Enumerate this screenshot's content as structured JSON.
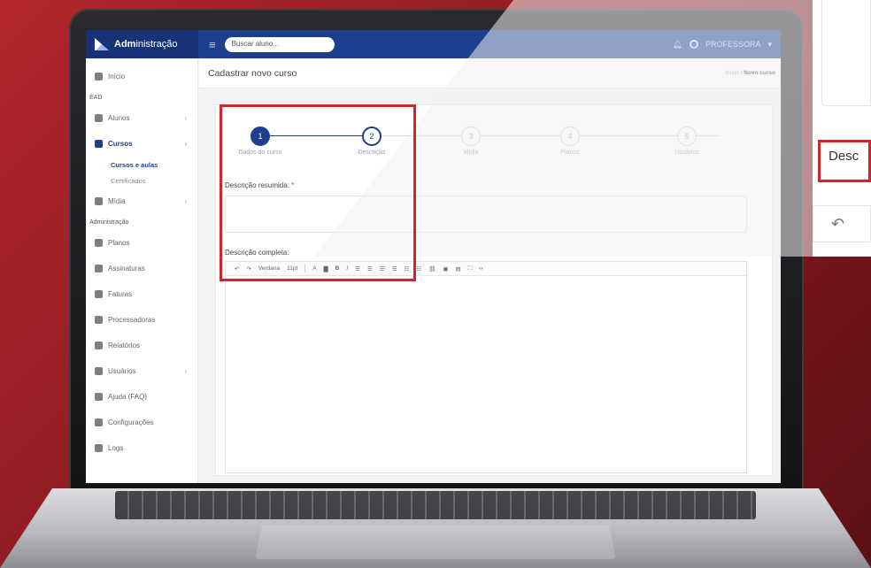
{
  "app": {
    "brand_bold": "Adm",
    "brand_rest": "inistração"
  },
  "topbar": {
    "search_placeholder": "Buscar aluno...",
    "user": "PROFESSORA"
  },
  "sidebar": {
    "items": [
      {
        "label": "Início",
        "icon": "home-icon"
      },
      {
        "section": "EAD"
      },
      {
        "label": "Alunos",
        "icon": "graduation-cap-icon",
        "chevron": true
      },
      {
        "label": "Cursos",
        "icon": "book-icon",
        "chevron": true,
        "active": true
      },
      {
        "sub": "Cursos e aulas",
        "active": true
      },
      {
        "sub": "Certificados"
      },
      {
        "label": "Mídia",
        "icon": "media-icon",
        "chevron": true
      },
      {
        "section": "Administração"
      },
      {
        "label": "Planos",
        "icon": "plane-icon"
      },
      {
        "label": "Assinaturas",
        "icon": "user-icon"
      },
      {
        "label": "Faturas",
        "icon": "invoice-icon"
      },
      {
        "label": "Processadoras",
        "icon": "card-icon"
      },
      {
        "label": "Relatórios",
        "icon": "chart-icon"
      },
      {
        "label": "Usuários",
        "icon": "users-icon",
        "chevron": true
      },
      {
        "label": "Ajuda (FAQ)",
        "icon": "help-icon"
      },
      {
        "label": "Configurações",
        "icon": "gears-icon"
      },
      {
        "label": "Logs",
        "icon": "logs-icon"
      }
    ]
  },
  "page": {
    "title": "Cadastrar novo curso",
    "crumb_home": "Início",
    "crumb_current": "Novo curso"
  },
  "steps": [
    {
      "num": "1",
      "label": "Dados do curso"
    },
    {
      "num": "2",
      "label": "Descrição"
    },
    {
      "num": "3",
      "label": "Mídia"
    },
    {
      "num": "4",
      "label": "Planos"
    },
    {
      "num": "5",
      "label": "Usuários"
    }
  ],
  "form": {
    "short_label": "Descrição resumida:",
    "required_mark": "*",
    "full_label": "Descrição completa:",
    "font_name": "Verdana",
    "font_size": "11pt"
  },
  "zoom": {
    "label": "Desc"
  }
}
